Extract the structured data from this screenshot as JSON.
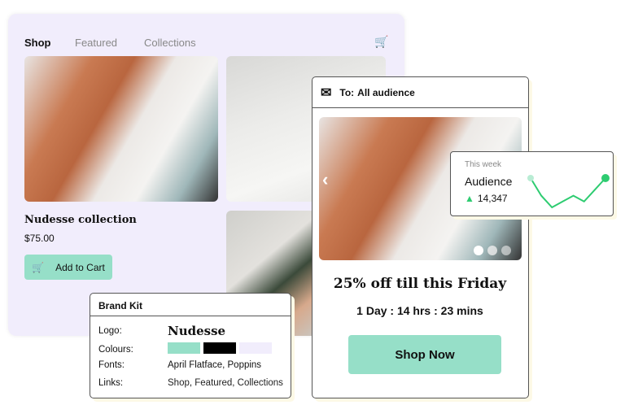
{
  "shop": {
    "nav": [
      "Shop",
      "Featured",
      "Collections"
    ],
    "cart_icon": "cart-icon",
    "product_title": "Nudesse collection",
    "price": "$75.00",
    "add_to_cart": "Add to Cart"
  },
  "email": {
    "to_label": "To:",
    "audience": "All audience",
    "headline": "25% off till this Friday",
    "countdown": "1 Day : 14 hrs : 23 mins",
    "cta": "Shop Now",
    "carousel_active": 1,
    "carousel_count": 3
  },
  "stats": {
    "period": "This week",
    "title": "Audience",
    "value": "14,347",
    "trend": "up",
    "sparkline": [
      6,
      3,
      1,
      2,
      3,
      2,
      4,
      6
    ],
    "color": "#2ecc71"
  },
  "brand": {
    "title": "Brand Kit",
    "logo_label": "Logo:",
    "logo": "Nudesse",
    "colours_label": "Colours:",
    "colours": [
      "#96dfc8",
      "#000000",
      "#f1edfc"
    ],
    "fonts_label": "Fonts:",
    "fonts": "April Flatface, Poppins",
    "links_label": "Links:",
    "links": [
      "Shop",
      "Featured",
      "Collections"
    ]
  }
}
